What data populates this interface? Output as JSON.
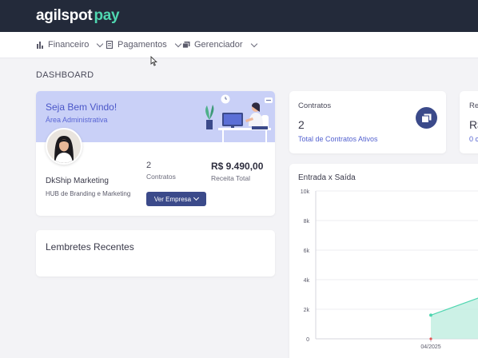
{
  "header": {
    "logo_part1": "agilspot",
    "logo_part2": "pay"
  },
  "nav": {
    "items": [
      {
        "label": "Financeiro",
        "icon": "bar-chart-icon"
      },
      {
        "label": "Pagamentos",
        "icon": "document-icon"
      },
      {
        "label": "Gerenciador",
        "icon": "folders-icon"
      }
    ]
  },
  "page": {
    "title": "DASHBOARD"
  },
  "welcome": {
    "title": "Seja Bem Vindo!",
    "subtitle": "Área Administrativa",
    "company_name": "DkShip Marketing",
    "company_sub": "HUB de Branding e Marketing",
    "contracts_value": "2",
    "contracts_label": "Contratos",
    "revenue_value": "R$ 9.490,00",
    "revenue_label": "Receita Total",
    "button_label": "Ver Empresa"
  },
  "lembretes": {
    "title": "Lembretes Recentes"
  },
  "contratos_card": {
    "title": "Contratos",
    "value": "2",
    "link": "Total de Contratos Ativos"
  },
  "extra_card": {
    "title": "Re",
    "value": "R$",
    "link": "0 c"
  },
  "colors": {
    "topbar": "#232a3a",
    "accent": "#3b4a8a",
    "band": "#c9d0f7",
    "logo_accent": "#4fd6b0",
    "area_fill": "#bfeee0",
    "area_stroke": "#4fd6b0"
  },
  "chart_data": {
    "type": "area",
    "title": "Entrada x Saída",
    "xlabel": "",
    "ylabel": "",
    "ylim": [
      0,
      10000
    ],
    "yticks": [
      "0",
      "2k",
      "4k",
      "6k",
      "8k",
      "10k"
    ],
    "x": [
      "04/2025"
    ],
    "series": [
      {
        "values": [
          1600
        ],
        "color": "#4fd6b0"
      }
    ],
    "grid": true,
    "legend": "none"
  }
}
